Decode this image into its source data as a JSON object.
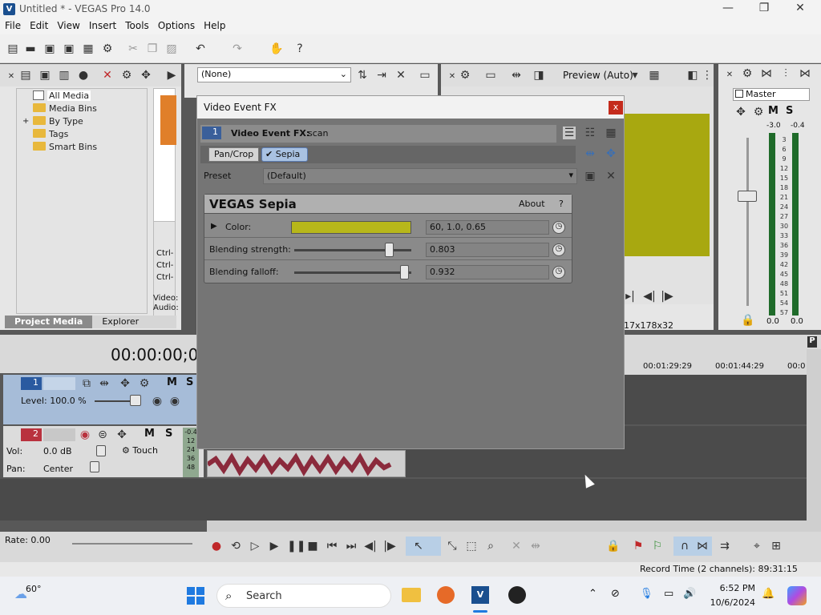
{
  "window": {
    "title": "Untitled * - VEGAS Pro 14.0",
    "min": "—",
    "max": "❐",
    "close": "✕"
  },
  "menu": [
    "File",
    "Edit",
    "View",
    "Insert",
    "Tools",
    "Options",
    "Help"
  ],
  "explorer": {
    "dropdown_value": "(None)",
    "tree": [
      "All Media",
      "Media Bins",
      "By Type",
      "Tags",
      "Smart Bins"
    ],
    "expand": "+",
    "tabs": [
      "Project Media",
      "Explorer"
    ],
    "ctrl_labels": [
      "Ctrl-",
      "Ctrl-",
      "Ctrl-"
    ],
    "info": [
      "Video:",
      "Audio:"
    ]
  },
  "preview": {
    "label": "Preview (Auto)",
    "frame_info": "17x178x32"
  },
  "master": {
    "label": "Master",
    "peak_left": "-3.0",
    "peak_right": "-0.4",
    "m": "M",
    "s": "S",
    "scale": [
      "3",
      "6",
      "9",
      "12",
      "15",
      "18",
      "21",
      "24",
      "27",
      "30",
      "33",
      "36",
      "39",
      "42",
      "45",
      "48",
      "51",
      "54",
      "57"
    ],
    "bottom_left": "0.0",
    "bottom_right": "0.0",
    "meter_color": "#1f6b2a"
  },
  "timeline": {
    "timecode": "00:00:00;00",
    "ruler": [
      "00:01:29:29",
      "00:01:44:29",
      "00:0"
    ],
    "tracks": [
      {
        "num": "1",
        "level": "Level: 100.0 %",
        "m": "M",
        "s": "S"
      },
      {
        "num": "2",
        "vol_label": "Vol:",
        "vol": "0.0 dB",
        "pan_label": "Pan:",
        "pan": "Center",
        "touch": "Touch",
        "m": "M",
        "s": "S"
      }
    ],
    "track_meter": [
      "-0.4",
      "12",
      "24",
      "36",
      "48"
    ],
    "rate": "Rate: 0.00",
    "record_time": "Record Time (2 channels): 89:31:15",
    "waveform_color": "#8b2a3c"
  },
  "dialog": {
    "title": "Video Event FX",
    "close": "x",
    "badge": "1",
    "fx_header_label": "Video Event FX:",
    "fx_header_value": "scan",
    "chain": [
      "Pan/Crop",
      "Sepia"
    ],
    "preset_label": "Preset",
    "preset_value": "(Default)",
    "plugin_name": "VEGAS Sepia",
    "about": "About",
    "help": "?",
    "params": [
      {
        "label": "Color:",
        "value": "60, 1.0, 0.65",
        "swatch": "#b7b71a"
      },
      {
        "label": "Blending strength:",
        "value": "0.803",
        "level": 0.803
      },
      {
        "label": "Blending falloff:",
        "value": "0.932",
        "level": 0.932
      }
    ]
  },
  "taskbar": {
    "weather": "60°",
    "search": "Search",
    "time": "6:52 PM",
    "date": "10/6/2024"
  }
}
